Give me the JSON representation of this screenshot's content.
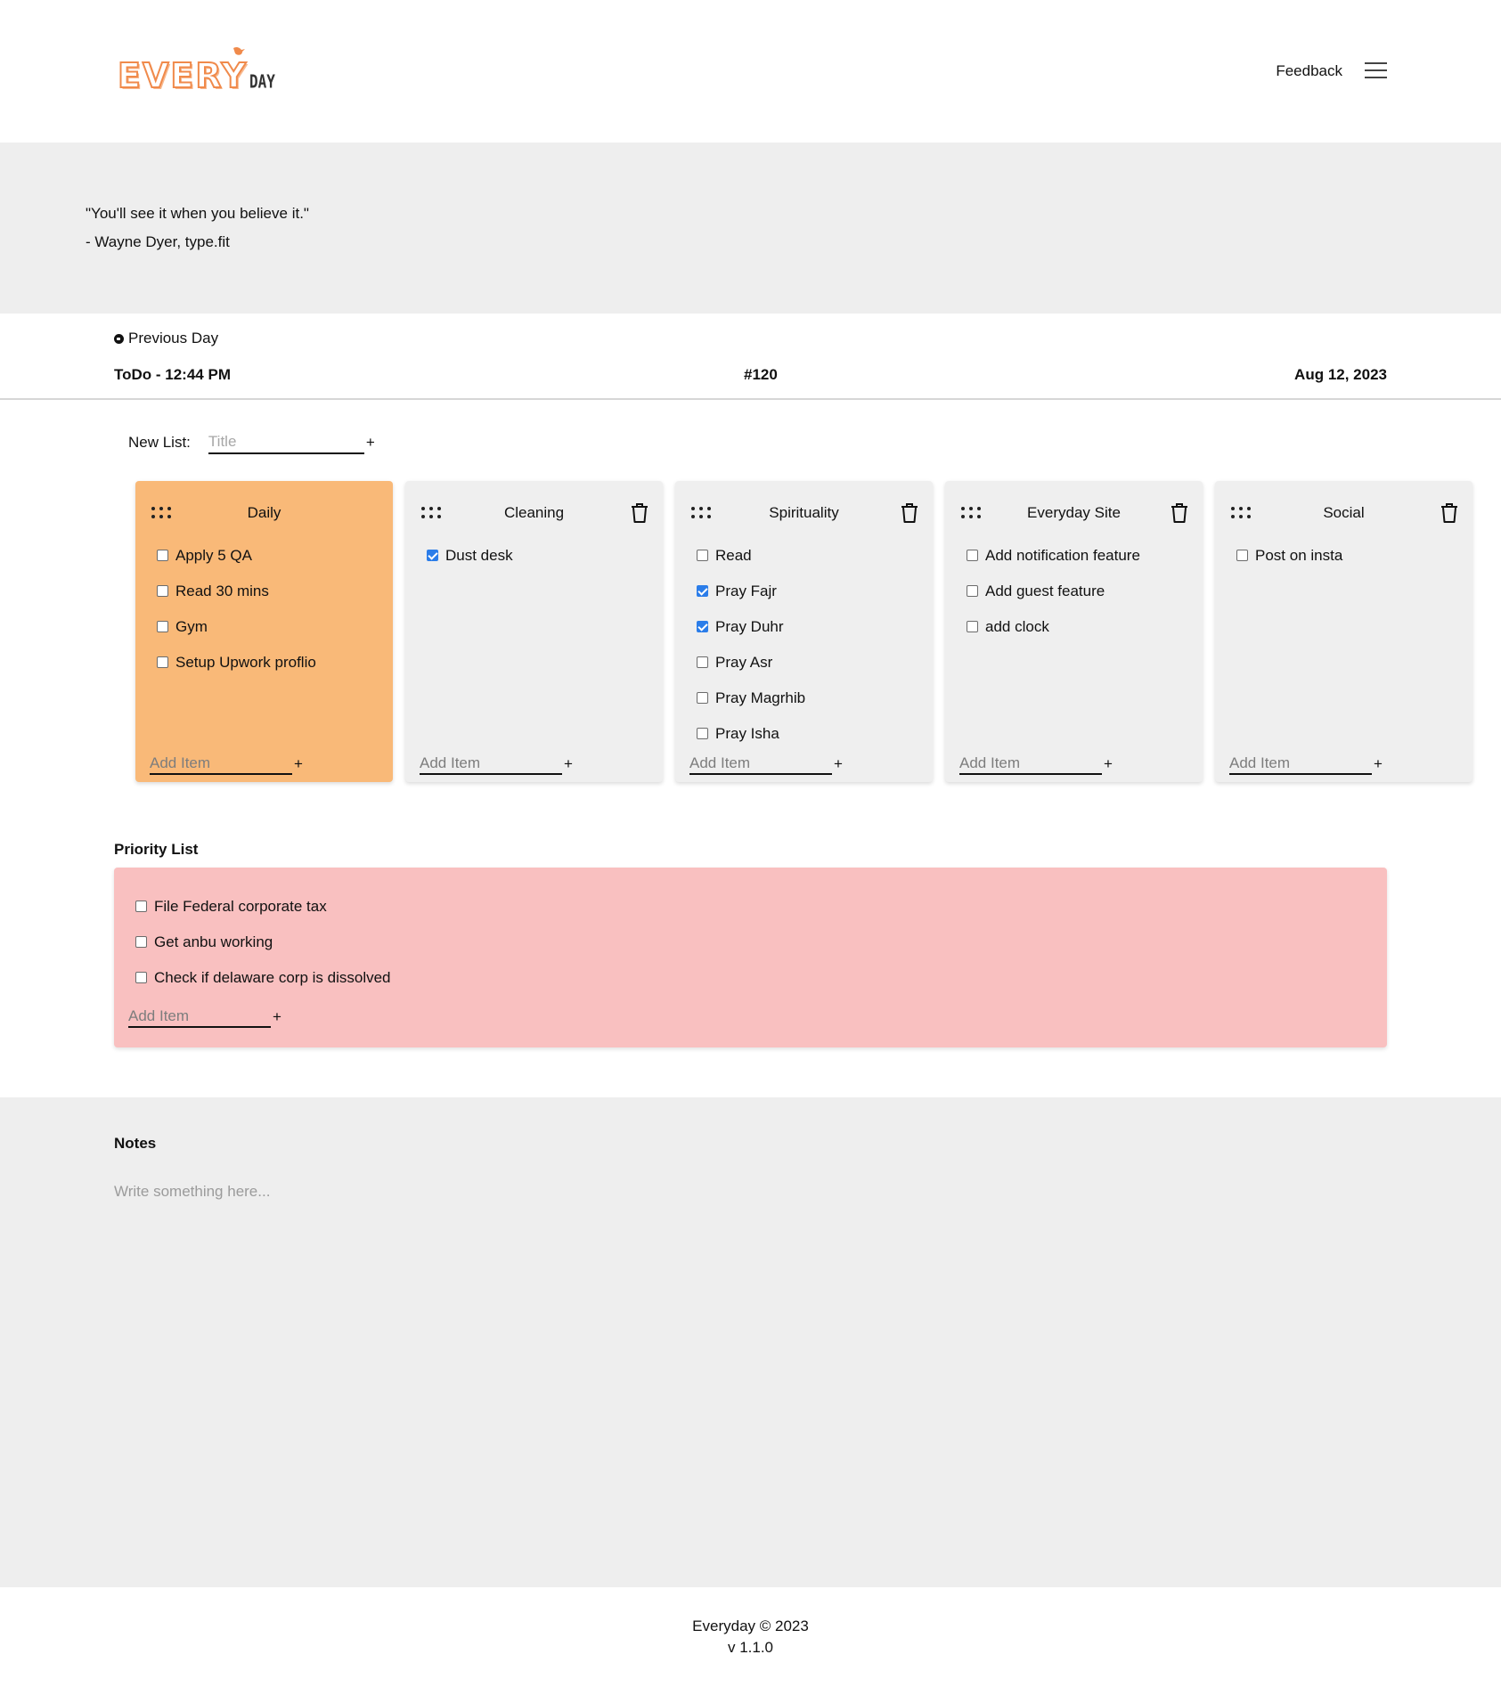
{
  "header": {
    "logo_main": "EVERY",
    "logo_sub": "DAY",
    "feedback_label": "Feedback"
  },
  "quote": {
    "text": "\"You'll see it when you believe it.\"",
    "author": "- Wayne Dyer, type.fit"
  },
  "day_bar": {
    "previous_label": "Previous Day",
    "todo_time": "ToDo - 12:44 PM",
    "day_number": "#120",
    "date": "Aug 12, 2023"
  },
  "new_list": {
    "label": "New List:",
    "placeholder": "Title",
    "add_symbol": "+"
  },
  "lists": [
    {
      "title": "Daily",
      "color": "#f9b978",
      "deletable": false,
      "items": [
        {
          "text": "Apply 5 QA",
          "checked": false
        },
        {
          "text": "Read 30 mins",
          "checked": false
        },
        {
          "text": "Gym",
          "checked": false
        },
        {
          "text": "Setup Upwork proflio",
          "checked": false
        }
      ],
      "add_placeholder": "Add Item",
      "add_symbol": "+"
    },
    {
      "title": "Cleaning",
      "color": "#efefef",
      "deletable": true,
      "items": [
        {
          "text": "Dust desk",
          "checked": true
        }
      ],
      "add_placeholder": "Add Item",
      "add_symbol": "+"
    },
    {
      "title": "Spirituality",
      "color": "#efefef",
      "deletable": true,
      "items": [
        {
          "text": "Read",
          "checked": false
        },
        {
          "text": "Pray Fajr",
          "checked": true
        },
        {
          "text": "Pray Duhr",
          "checked": true
        },
        {
          "text": "Pray Asr",
          "checked": false
        },
        {
          "text": "Pray Magrhib",
          "checked": false
        },
        {
          "text": "Pray Isha",
          "checked": false
        }
      ],
      "add_placeholder": "Add Item",
      "add_symbol": "+"
    },
    {
      "title": "Everyday Site",
      "color": "#efefef",
      "deletable": true,
      "items": [
        {
          "text": "Add notification feature",
          "checked": false
        },
        {
          "text": "Add guest feature",
          "checked": false
        },
        {
          "text": "add clock",
          "checked": false
        }
      ],
      "add_placeholder": "Add Item",
      "add_symbol": "+"
    },
    {
      "title": "Social",
      "color": "#efefef",
      "deletable": true,
      "items": [
        {
          "text": "Post on insta",
          "checked": false
        }
      ],
      "add_placeholder": "Add Item",
      "add_symbol": "+"
    }
  ],
  "priority": {
    "label": "Priority List",
    "color": "#f9c0c0",
    "items": [
      {
        "text": "File Federal corporate tax",
        "checked": false
      },
      {
        "text": "Get anbu working",
        "checked": false
      },
      {
        "text": "Check if delaware corp is dissolved",
        "checked": false
      }
    ],
    "add_placeholder": "Add Item",
    "add_symbol": "+"
  },
  "notes": {
    "label": "Notes",
    "placeholder": "Write something here..."
  },
  "footer": {
    "copyright": "Everyday © 2023",
    "version": "v 1.1.0"
  },
  "colors": {
    "accent": "#f08a4b",
    "checkbox_checked": "#2b7de9",
    "band_gray": "#eeeeee"
  }
}
